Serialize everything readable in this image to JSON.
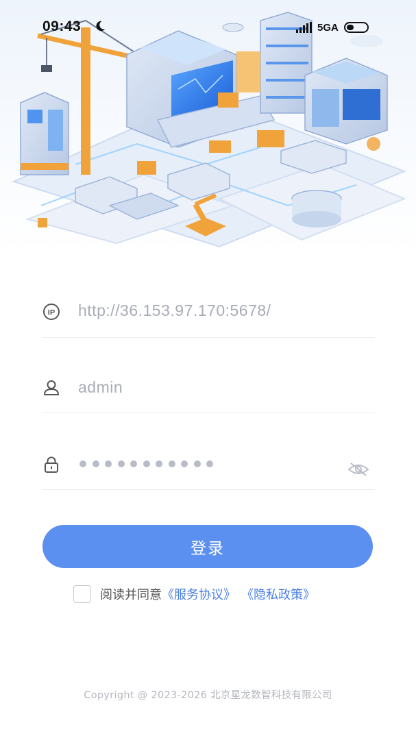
{
  "status_bar": {
    "time": "09:43",
    "network": "5GA"
  },
  "form": {
    "server_url": "http://36.153.97.170:5678/",
    "username": "admin",
    "password_mask_count": 11
  },
  "login_button": "登录",
  "agreement": {
    "text": "阅读并同意",
    "service_link": "《服务协议》",
    "privacy_link": "《隐私政策》"
  },
  "copyright": "Copyright @ 2023-2026 北京星龙数智科技有限公司",
  "icons": [
    "moon-icon",
    "signal-icon",
    "battery-icon",
    "ip-icon",
    "user-icon",
    "lock-icon",
    "eye-hidden-icon"
  ],
  "colors": {
    "primary": "#5b8ff0",
    "link": "#4a7fe0",
    "placeholder": "#a8acb6"
  }
}
